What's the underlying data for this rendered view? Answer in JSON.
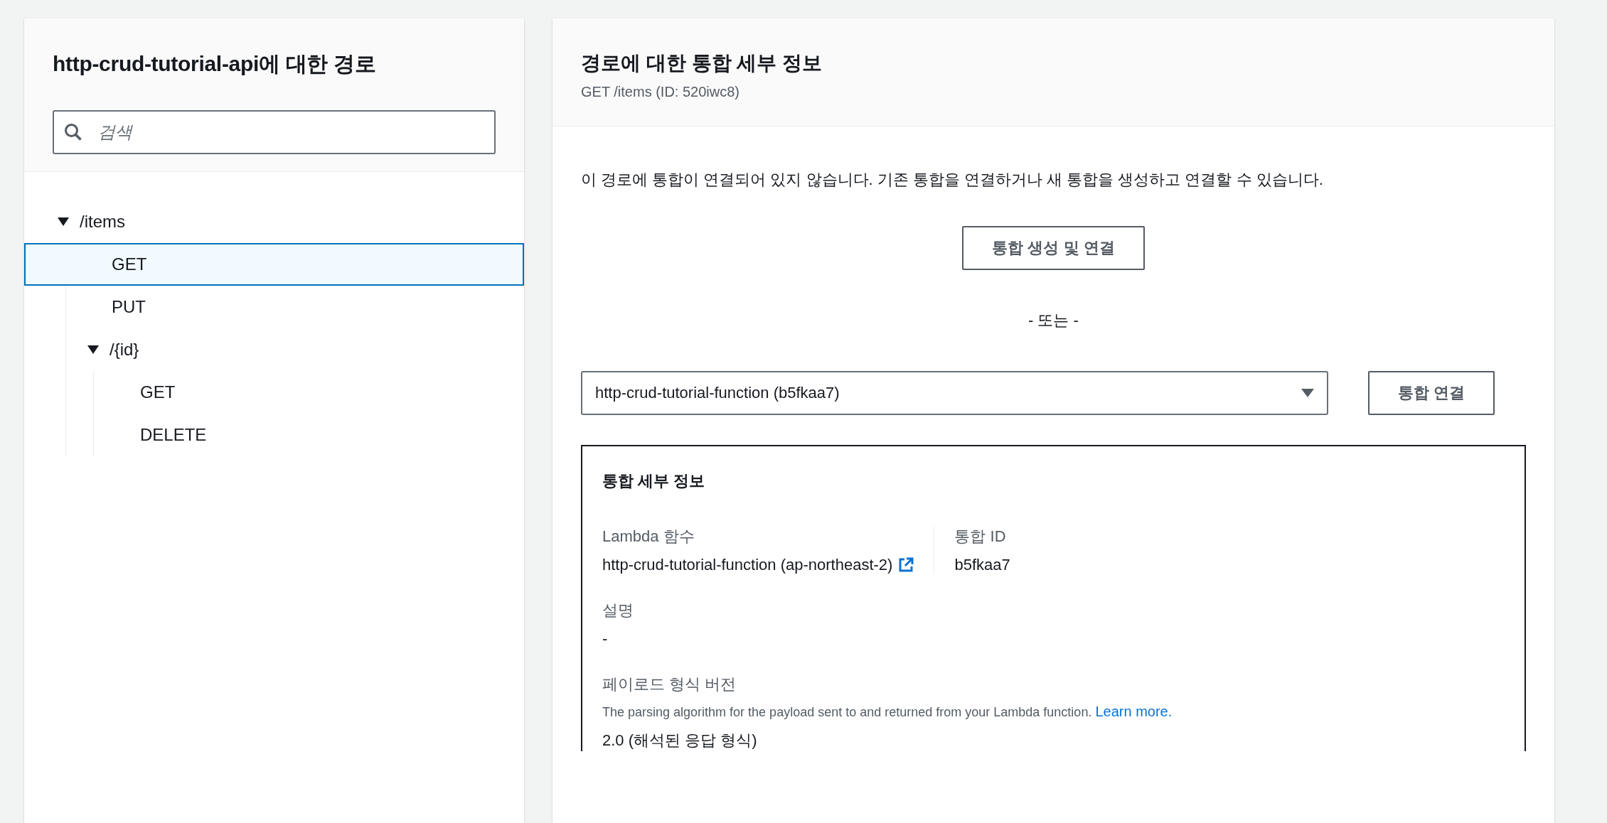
{
  "routes_panel": {
    "title": "http-crud-tutorial-api에 대한 경로",
    "search": {
      "placeholder": "검색"
    },
    "tree": [
      {
        "label": "/items",
        "expanded": true,
        "children": [
          {
            "label": "GET",
            "selected": true
          },
          {
            "label": "PUT",
            "selected": false
          },
          {
            "label": "/{id}",
            "expanded": true,
            "children": [
              {
                "label": "GET",
                "selected": false
              },
              {
                "label": "DELETE",
                "selected": false
              }
            ]
          }
        ]
      }
    ]
  },
  "detail_panel": {
    "title": "경로에 대한 통합 세부 정보",
    "subtitle": "GET /items (ID: 520iwc8)",
    "message": "이 경로에 통합이 연결되어 있지 않습니다. 기존 통합을 연결하거나 새 통합을 생성하고 연결할 수 있습니다.",
    "create_button": "통합 생성 및 연결",
    "separator": "- 또는 -",
    "integration_select": {
      "value": "http-crud-tutorial-function (b5fkaa7)"
    },
    "attach_button": "통합 연결",
    "details_card": {
      "title": "통합 세부 정보",
      "lambda_function": {
        "label": "Lambda 함수",
        "value": "http-crud-tutorial-function (ap-northeast-2)"
      },
      "integration_id": {
        "label": "통합 ID",
        "value": "b5fkaa7"
      },
      "description": {
        "label": "설명",
        "value": "-"
      },
      "payload_format": {
        "label": "페이로드 형식 버전",
        "help": "The parsing algorithm for the payload sent to and returned from your Lambda function.",
        "link": "Learn more.",
        "value": "2.0 (해석된 응답 형식)"
      }
    }
  }
}
